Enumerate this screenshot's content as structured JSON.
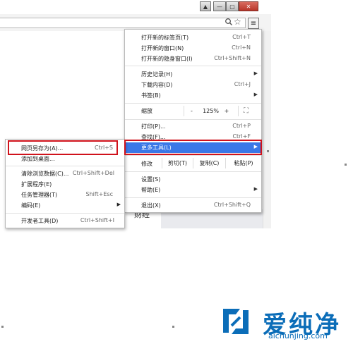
{
  "window_controls": {
    "pin": "▲",
    "minimize": "—",
    "maximize": "▢",
    "close": "✕"
  },
  "toolbar": {
    "zoom_icon": "search-icon",
    "star_icon": "bookmark-star-icon",
    "menu_icon": "≡"
  },
  "background_text": "财经",
  "main_menu": {
    "items": [
      {
        "label": "打开新的标签页(T)",
        "shortcut": "Ctrl+T"
      },
      {
        "label": "打开新的窗口(N)",
        "shortcut": "Ctrl+N"
      },
      {
        "label": "打开新的隐身窗口(I)",
        "shortcut": "Ctrl+Shift+N"
      },
      {
        "label": "历史记录(H)",
        "shortcut": "▶"
      },
      {
        "label": "下载内容(D)",
        "shortcut": "Ctrl+J"
      },
      {
        "label": "书签(B)",
        "shortcut": "▶"
      },
      {
        "label": "打印(P)...",
        "shortcut": "Ctrl+P"
      },
      {
        "label": "查找(F)...",
        "shortcut": "Ctrl+F"
      },
      {
        "label": "更多工具(L)",
        "shortcut": "▶"
      },
      {
        "label": "设置(S)",
        "shortcut": ""
      },
      {
        "label": "帮助(E)",
        "shortcut": "▶"
      },
      {
        "label": "退出(X)",
        "shortcut": "Ctrl+Shift+Q"
      }
    ],
    "zoom": {
      "label": "缩放",
      "minus": "-",
      "value": "125%",
      "plus": "+",
      "fullscreen": "⛶"
    },
    "edit": {
      "label": "修改",
      "cut": "剪切(T)",
      "copy": "复制(C)",
      "paste": "粘贴(P)"
    }
  },
  "sub_menu": {
    "items": [
      {
        "label": "网页另存为(A)...",
        "shortcut": "Ctrl+S"
      },
      {
        "label": "添加到桌面...",
        "shortcut": ""
      },
      {
        "label": "清除浏览数据(C)...",
        "shortcut": "Ctrl+Shift+Del"
      },
      {
        "label": "扩展程序(E)",
        "shortcut": ""
      },
      {
        "label": "任务管理器(T)",
        "shortcut": "Shift+Esc"
      },
      {
        "label": "编码(E)",
        "shortcut": "▶"
      },
      {
        "label": "开发者工具(D)",
        "shortcut": "Ctrl+Shift+I"
      }
    ]
  },
  "watermark": {
    "brand": "爱纯净",
    "url": "aichunjing.com",
    "accent": "#0b6db8"
  },
  "colors": {
    "highlight": "#3a78e7",
    "annotation_red": "#d0121b"
  }
}
